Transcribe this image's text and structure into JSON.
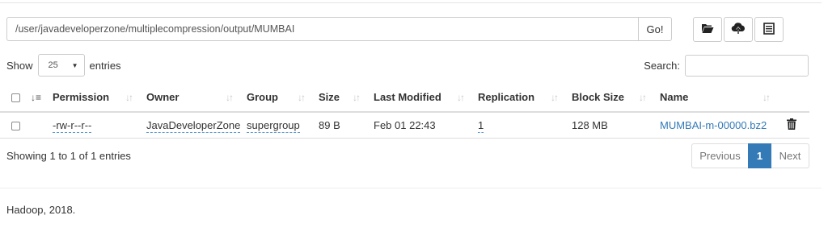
{
  "path_bar": {
    "path_value": "/user/javadeveloperzone/multiplecompression/output/MUMBAI",
    "go_label": "Go!"
  },
  "toolbar": {
    "icons": [
      "folder-open-icon",
      "cloud-upload-icon",
      "list-alt-icon"
    ]
  },
  "length": {
    "show_label": "Show",
    "selected": "25",
    "entries_label": "entries"
  },
  "search": {
    "label": "Search:",
    "value": ""
  },
  "table": {
    "headers": [
      "Permission",
      "Owner",
      "Group",
      "Size",
      "Last Modified",
      "Replication",
      "Block Size",
      "Name"
    ],
    "rows": [
      {
        "permission": "-rw-r--r--",
        "owner": "JavaDeveloperZone",
        "group": "supergroup",
        "size": "89 B",
        "last_modified": "Feb 01 22:43",
        "replication": "1",
        "block_size": "128 MB",
        "name": "MUMBAI-m-00000.bz2"
      }
    ]
  },
  "info": "Showing 1 to 1 of 1 entries",
  "pagination": {
    "previous": "Previous",
    "current": "1",
    "next": "Next"
  },
  "footer": "Hadoop, 2018.",
  "colors": {
    "link": "#337ab7",
    "active_page": "#337ab7",
    "border": "#dddddd"
  }
}
